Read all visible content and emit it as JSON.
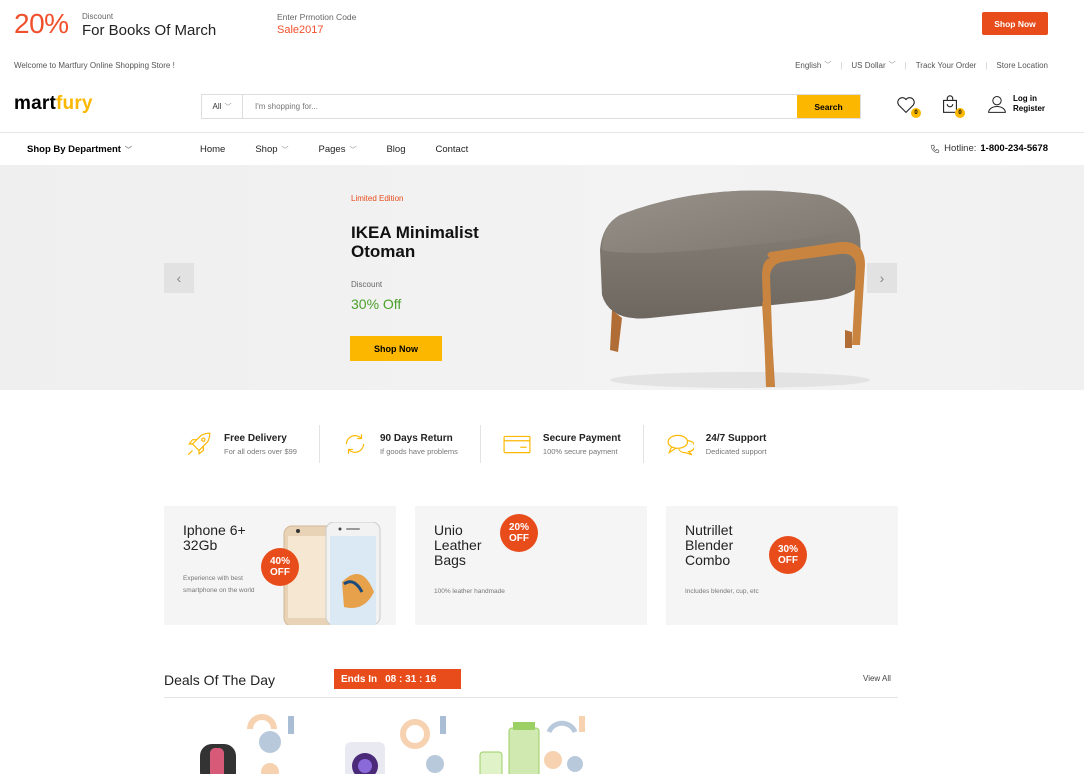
{
  "promo": {
    "percent": "20%",
    "discount_label": "Discount",
    "text": "For Books Of March",
    "code_label": "Enter Prmotion Code",
    "code": "Sale2017",
    "button": "Shop Now"
  },
  "topbar": {
    "welcome": "Welcome to Martfury Online Shopping Store !",
    "language": "English",
    "currency": "US Dollar",
    "track": "Track Your Order",
    "store": "Store Location"
  },
  "header": {
    "logo_main": "mart",
    "logo_accent": "fury",
    "search_category": "All",
    "search_placeholder": "I'm shopping for...",
    "search_button": "Search",
    "wishlist_count": "0",
    "cart_count": "0",
    "login": "Log in",
    "register": "Register"
  },
  "nav": {
    "department": "Shop By Department",
    "links": [
      "Home",
      "Shop",
      "Pages",
      "Blog",
      "Contact"
    ],
    "hotline_label": "Hotline:",
    "hotline_number": "1-800-234-5678"
  },
  "hero": {
    "label": "Limited Edition",
    "title": "IKEA Minimalist Otoman",
    "discount_label": "Discount",
    "discount": "30% Off",
    "button": "Shop Now"
  },
  "features": [
    {
      "title": "Free Delivery",
      "sub": "For all oders over $99",
      "icon": "rocket-icon"
    },
    {
      "title": "90 Days Return",
      "sub": "If goods have problems",
      "icon": "refresh-icon"
    },
    {
      "title": "Secure Payment",
      "sub": "100% secure payment",
      "icon": "credit-card-icon"
    },
    {
      "title": "24/7 Support",
      "sub": "Dedicated support",
      "icon": "chat-icon"
    }
  ],
  "cards": [
    {
      "title": "Iphone 6+ 32Gb",
      "sub": "Experience with best smartphone on the world",
      "off": "40%",
      "off_word": "OFF"
    },
    {
      "title": "Unio Leather Bags",
      "sub": "100% leather handmade",
      "off": "20%",
      "off_word": "OFF"
    },
    {
      "title": "Nutrillet Blender Combo",
      "sub": "Includes blender, cup, etc",
      "off": "30%",
      "off_word": "OFF"
    }
  ],
  "deals": {
    "title": "Deals Of The Day",
    "ends_label": "Ends In",
    "timer": "08 : 31 : 16",
    "view_all": "View All"
  },
  "colors": {
    "accent_yellow": "#fcb800",
    "accent_red": "#e84c1b",
    "green": "#4aa02c"
  }
}
